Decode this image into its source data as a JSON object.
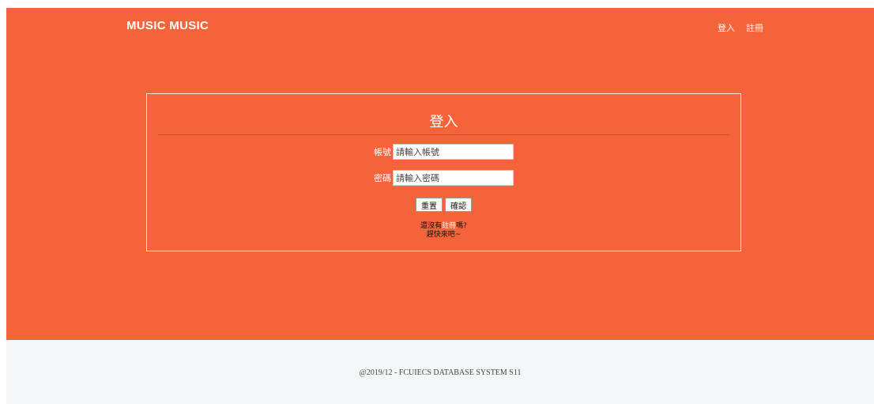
{
  "header": {
    "brand": "MUSIC MUSIC",
    "nav": {
      "login": "登入",
      "register": "註冊"
    }
  },
  "login_card": {
    "title": "登入",
    "username": {
      "label": "帳號",
      "placeholder": "請輸入帳號"
    },
    "password": {
      "label": "密碼",
      "placeholder": "請輸入密碼"
    },
    "reset_label": "重置",
    "submit_label": "確認",
    "hint": {
      "prefix": "還沒有",
      "link": "註冊",
      "suffix": "嗎?",
      "line2": "趕快來吧~"
    }
  },
  "footer": {
    "copyright": "@2019/12 - FCUIECS DATABASE SYSTEM S11"
  },
  "colors": {
    "accent": "#f4633a",
    "footer_bg": "#f5f6f7"
  }
}
